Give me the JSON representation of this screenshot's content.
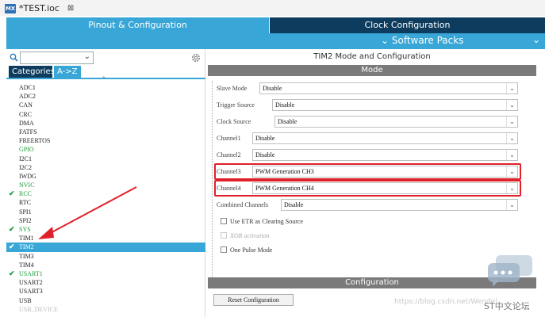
{
  "file_tab": {
    "icon": "MX",
    "label": "*TEST.ioc",
    "close": "⊠"
  },
  "main_tabs": {
    "pinout": "Pinout & Configuration",
    "clock": "Clock Configuration"
  },
  "subbar": {
    "software_packs": "⌄ Software Packs",
    "chevron": "⌄"
  },
  "left": {
    "search": {
      "value": "",
      "placeholder": "",
      "chevron": "⌄"
    },
    "tabs": {
      "categories": "Categories",
      "atoz": "A->Z"
    },
    "collapse": "⌃",
    "items": [
      {
        "label": "ADC1",
        "state": "normal",
        "check": ""
      },
      {
        "label": "ADC2",
        "state": "normal",
        "check": ""
      },
      {
        "label": "CAN",
        "state": "normal",
        "check": ""
      },
      {
        "label": "CRC",
        "state": "normal",
        "check": ""
      },
      {
        "label": "DMA",
        "state": "normal",
        "check": ""
      },
      {
        "label": "FATFS",
        "state": "normal",
        "check": ""
      },
      {
        "label": "FREERTOS",
        "state": "normal",
        "check": ""
      },
      {
        "label": "GPIO",
        "state": "green",
        "check": ""
      },
      {
        "label": "I2C1",
        "state": "normal",
        "check": ""
      },
      {
        "label": "I2C2",
        "state": "normal",
        "check": ""
      },
      {
        "label": "IWDG",
        "state": "normal",
        "check": ""
      },
      {
        "label": "NVIC",
        "state": "green",
        "check": ""
      },
      {
        "label": "RCC",
        "state": "green",
        "check": "✔"
      },
      {
        "label": "RTC",
        "state": "normal",
        "check": ""
      },
      {
        "label": "SPI1",
        "state": "normal",
        "check": ""
      },
      {
        "label": "SPI2",
        "state": "normal",
        "check": ""
      },
      {
        "label": "SYS",
        "state": "green",
        "check": "✔"
      },
      {
        "label": "TIM1",
        "state": "normal",
        "check": ""
      },
      {
        "label": "TIM2",
        "state": "sel",
        "check": "✔"
      },
      {
        "label": "TIM3",
        "state": "normal",
        "check": ""
      },
      {
        "label": "TIM4",
        "state": "normal",
        "check": ""
      },
      {
        "label": "USART1",
        "state": "green",
        "check": "✔"
      },
      {
        "label": "USART2",
        "state": "normal",
        "check": ""
      },
      {
        "label": "USART3",
        "state": "normal",
        "check": ""
      },
      {
        "label": "USB",
        "state": "normal",
        "check": ""
      },
      {
        "label": "USB_DEVICE",
        "state": "faded",
        "check": ""
      }
    ]
  },
  "right": {
    "title": "TIM2 Mode and Configuration",
    "mode_header": "Mode",
    "fields": [
      {
        "label": "Slave Mode",
        "value": "Disable",
        "highlighted": false
      },
      {
        "label": "Trigger Source",
        "value": "Disable",
        "highlighted": false
      },
      {
        "label": "Clock Source",
        "value": "Disable",
        "highlighted": false
      },
      {
        "label": "Channel1",
        "value": "Disable",
        "highlighted": false
      },
      {
        "label": "Channel2",
        "value": "Disable",
        "highlighted": false
      },
      {
        "label": "Channel3",
        "value": "PWM Generation CH3",
        "highlighted": true
      },
      {
        "label": "Channel4",
        "value": "PWM Generation CH4",
        "highlighted": true
      },
      {
        "label": "Combined Channels",
        "value": "Disable",
        "highlighted": false
      }
    ],
    "checkboxes": [
      {
        "label": "Use ETR as Clearing Source",
        "enabled": true,
        "checked": false
      },
      {
        "label": "XOR activation",
        "enabled": false,
        "checked": false
      },
      {
        "label": "One Pulse Mode",
        "enabled": true,
        "checked": false
      }
    ],
    "config_header": "Configuration",
    "reset_button": "Reset Configuration"
  },
  "watermark": {
    "url": "https://blog.csdn.net/Wendel",
    "brand": "ST中文论坛"
  },
  "colors": {
    "accent": "#38a6d6",
    "dark_tab": "#0d3c5e",
    "highlight_red": "#e0202a",
    "check_green": "#1c9c3a",
    "section_gray": "#7a7a7a"
  }
}
